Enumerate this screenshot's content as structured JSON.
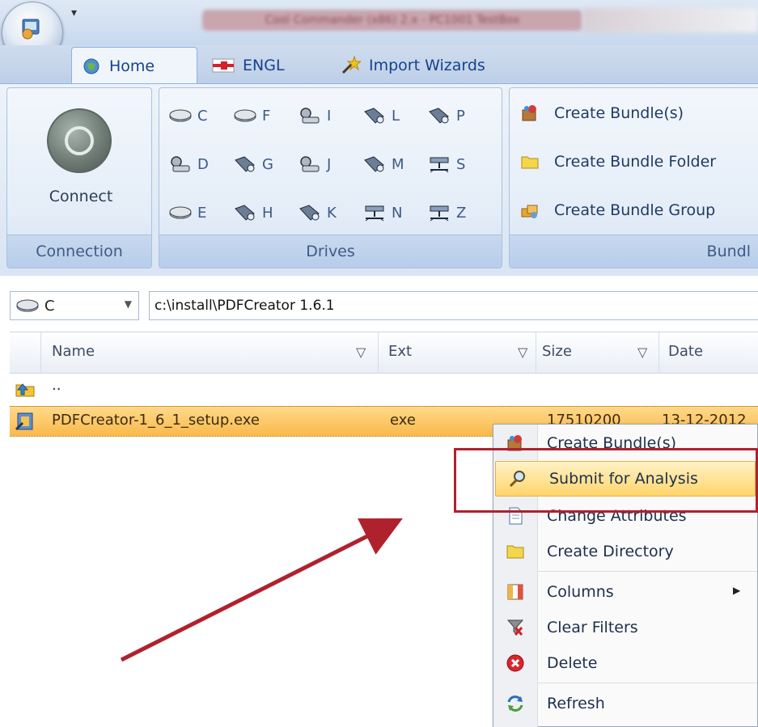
{
  "window": {
    "title": "Cool Commander (x86) 2.x - PC1001 TestBox",
    "quick_access_arrow": "▾"
  },
  "tabs": [
    {
      "label": "Home",
      "icon": "home-globe-icon"
    },
    {
      "label": "ENGL",
      "icon": "engl-flag-icon"
    },
    {
      "label": "Import Wizards",
      "icon": "wand-icon"
    }
  ],
  "ribbon": {
    "connection": {
      "caption": "Connection",
      "connect_label": "Connect"
    },
    "drives": {
      "caption": "Drives",
      "items": [
        {
          "letter": "C",
          "icon": "hdd-icon"
        },
        {
          "letter": "F",
          "icon": "hdd-icon"
        },
        {
          "letter": "I",
          "icon": "network-drive-icon"
        },
        {
          "letter": "L",
          "icon": "removable-drive-icon"
        },
        {
          "letter": "P",
          "icon": "removable-drive-icon"
        },
        {
          "letter": "D",
          "icon": "network-drive-icon"
        },
        {
          "letter": "G",
          "icon": "removable-drive-icon"
        },
        {
          "letter": "J",
          "icon": "network-drive-icon"
        },
        {
          "letter": "M",
          "icon": "removable-drive-icon"
        },
        {
          "letter": "S",
          "icon": "mapped-drive-icon"
        },
        {
          "letter": "E",
          "icon": "hdd-icon"
        },
        {
          "letter": "H",
          "icon": "removable-drive-icon"
        },
        {
          "letter": "K",
          "icon": "removable-drive-icon"
        },
        {
          "letter": "N",
          "icon": "mapped-drive-icon"
        },
        {
          "letter": "Z",
          "icon": "mapped-drive-icon"
        }
      ]
    },
    "bundle": {
      "caption": "Bundl",
      "items": [
        {
          "label": "Create Bundle(s)",
          "icon": "bundle-icon"
        },
        {
          "label": "Create Bundle Folder",
          "icon": "folder-icon"
        },
        {
          "label": "Create Bundle Group",
          "icon": "bundle-group-icon"
        }
      ]
    }
  },
  "pathbar": {
    "drive": "C",
    "path": "c:\\install\\PDFCreator 1.6.1"
  },
  "grid": {
    "columns": [
      {
        "label": "Name"
      },
      {
        "label": "Ext"
      },
      {
        "label": "Size"
      },
      {
        "label": "Date"
      }
    ],
    "rows": [
      {
        "name": "..",
        "ext": "",
        "size": "",
        "date": ""
      },
      {
        "name": "PDFCreator-1_6_1_setup.exe",
        "ext": "exe",
        "size": "17510200",
        "date": "13-12-2012"
      }
    ]
  },
  "context_menu": {
    "items": [
      {
        "label": "Create Bundle(s)",
        "icon": "bundle-icon"
      },
      {
        "label": "Submit for Analysis",
        "icon": "magnifier-icon",
        "highlighted": true
      },
      {
        "label": "Change Attributes",
        "icon": "document-icon"
      },
      {
        "label": "Create Directory",
        "icon": "folder-icon"
      },
      {
        "label": "Columns",
        "icon": "columns-icon",
        "has_submenu": true
      },
      {
        "label": "Clear Filters",
        "icon": "clear-filter-icon"
      },
      {
        "label": "Delete",
        "icon": "delete-icon"
      },
      {
        "label": "Refresh",
        "icon": "refresh-icon"
      }
    ]
  },
  "colors": {
    "accent_red": "#b0212e",
    "selection": "#f9b94b",
    "ribbon_blue": "#15428b"
  }
}
